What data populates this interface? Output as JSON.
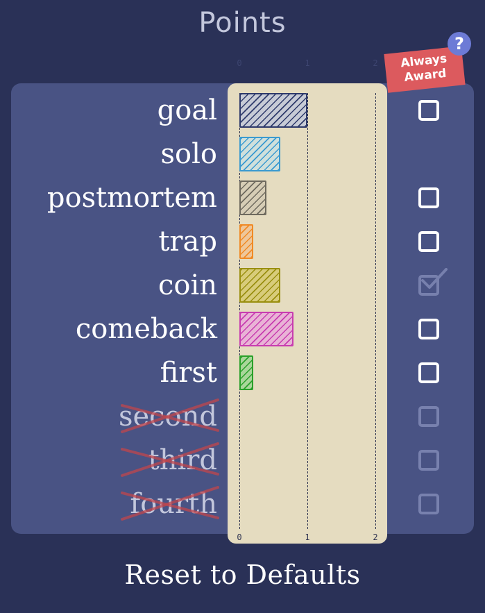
{
  "header": {
    "title": "Points"
  },
  "always_award": {
    "label_line1": "Always",
    "label_line2": "Award"
  },
  "help": {
    "label": "?"
  },
  "axis": {
    "ticks": [
      "0",
      "1",
      "2"
    ],
    "range": [
      0,
      2
    ]
  },
  "rows": [
    {
      "label": "goal",
      "value": 1.0,
      "color": "#2e3a6b",
      "fill": "#c7cbd6",
      "enabled": true,
      "has_checkbox": true,
      "checked": false,
      "checkbox_dim": false
    },
    {
      "label": "solo",
      "value": 0.6,
      "color": "#3a9ad0",
      "fill": "#cfe0dc",
      "enabled": true,
      "has_checkbox": false,
      "checked": false,
      "checkbox_dim": false
    },
    {
      "label": "postmortem",
      "value": 0.4,
      "color": "#6e6a5e",
      "fill": "#d6cdb5",
      "enabled": true,
      "has_checkbox": true,
      "checked": false,
      "checkbox_dim": false
    },
    {
      "label": "trap",
      "value": 0.2,
      "color": "#f08a24",
      "fill": "#eec79a",
      "enabled": true,
      "has_checkbox": true,
      "checked": false,
      "checkbox_dim": false
    },
    {
      "label": "coin",
      "value": 0.6,
      "color": "#9a8f10",
      "fill": "#d8cc7a",
      "enabled": true,
      "has_checkbox": true,
      "checked": true,
      "checkbox_dim": true
    },
    {
      "label": "comeback",
      "value": 0.8,
      "color": "#c83cb0",
      "fill": "#e9b3d6",
      "enabled": true,
      "has_checkbox": true,
      "checked": false,
      "checkbox_dim": false
    },
    {
      "label": "first",
      "value": 0.2,
      "color": "#2aa02a",
      "fill": "#a9d69a",
      "enabled": true,
      "has_checkbox": true,
      "checked": false,
      "checkbox_dim": false
    },
    {
      "label": "second",
      "value": 0,
      "color": "#c0464c",
      "fill": "#e5dcc0",
      "enabled": false,
      "has_checkbox": true,
      "checked": false,
      "checkbox_dim": true
    },
    {
      "label": "third",
      "value": 0,
      "color": "#c0464c",
      "fill": "#e5dcc0",
      "enabled": false,
      "has_checkbox": true,
      "checked": false,
      "checkbox_dim": true
    },
    {
      "label": "fourth",
      "value": 0,
      "color": "#c0464c",
      "fill": "#e5dcc0",
      "enabled": false,
      "has_checkbox": true,
      "checked": false,
      "checkbox_dim": true
    }
  ],
  "footer": {
    "reset_label": "Reset to Defaults"
  },
  "chart_data": {
    "type": "bar",
    "categories": [
      "goal",
      "solo",
      "postmortem",
      "trap",
      "coin",
      "comeback",
      "first",
      "second",
      "third",
      "fourth"
    ],
    "values": [
      1.0,
      0.6,
      0.4,
      0.2,
      0.6,
      0.8,
      0.2,
      0,
      0,
      0
    ],
    "title": "Points",
    "xlabel": "",
    "ylabel": "",
    "xlim": [
      0,
      2
    ],
    "orientation": "horizontal",
    "grid": true
  }
}
